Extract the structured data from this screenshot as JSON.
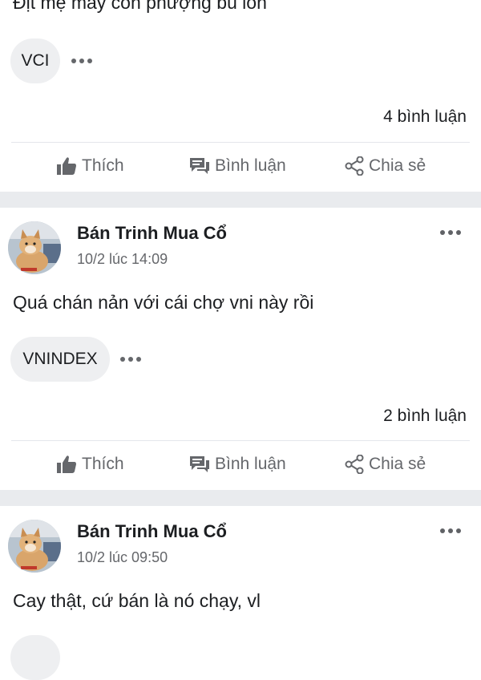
{
  "posts": [
    {
      "text": "Địt mẹ mấy con phượng bú lồn",
      "tag": "VCI",
      "comments": "4 bình luận"
    },
    {
      "author": "Bán Trinh Mua Cổ",
      "time": "10/2 lúc 14:09",
      "text": "Quá chán nản với cái chợ vni này rồi",
      "tag": "VNINDEX",
      "comments": "2 bình luận"
    },
    {
      "author": "Bán Trinh Mua Cổ",
      "time": "10/2 lúc 09:50",
      "text": "Cay thật, cứ bán là nó chạy, vl"
    }
  ],
  "actions": {
    "like": "Thích",
    "comment": "Bình luận",
    "share": "Chia sẻ"
  },
  "icons": {
    "like": "thumbs-up-icon",
    "comment": "comment-icon",
    "share": "share-icon",
    "more": "more-dots-icon"
  },
  "colors": {
    "text": "#1c1e21",
    "secondary": "#65676b",
    "pill_bg": "#eeeff1",
    "separator": "#e9ebee"
  }
}
